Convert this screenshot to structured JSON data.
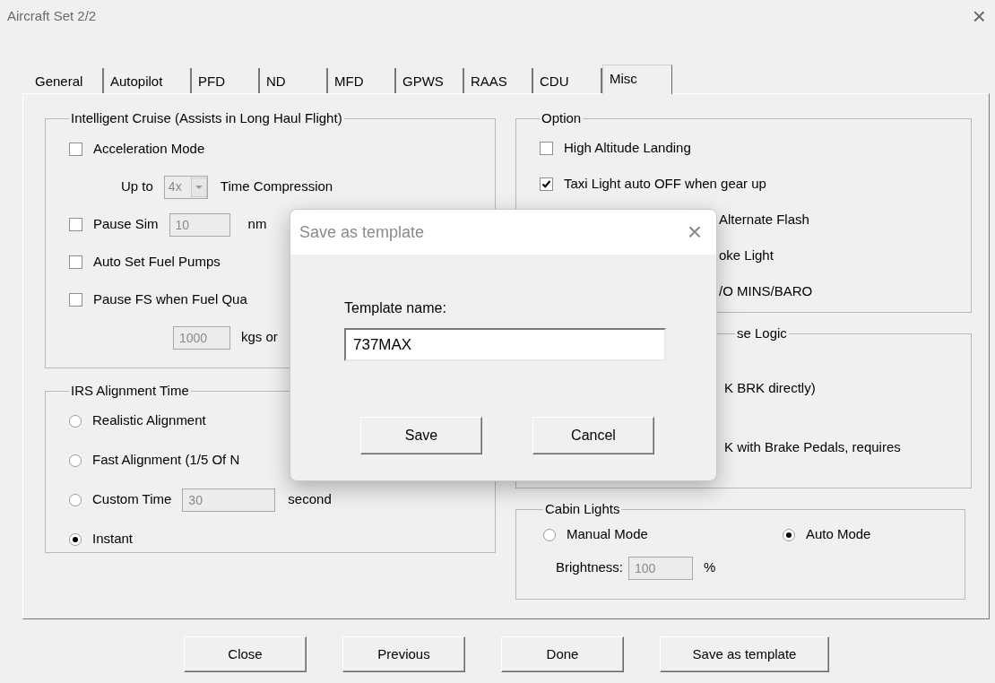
{
  "window": {
    "title": "Aircraft Set 2/2",
    "close": "×"
  },
  "tabs": [
    {
      "label": "General",
      "selected": false
    },
    {
      "label": "Autopilot",
      "selected": false
    },
    {
      "label": "PFD",
      "selected": false
    },
    {
      "label": "ND",
      "selected": false
    },
    {
      "label": "MFD",
      "selected": false
    },
    {
      "label": "GPWS",
      "selected": false
    },
    {
      "label": "RAAS",
      "selected": false
    },
    {
      "label": "CDU",
      "selected": false
    },
    {
      "label": "Misc",
      "selected": true
    }
  ],
  "intelligent_cruise": {
    "title": "Intelligent Cruise (Assists in Long Haul Flight)",
    "rows": [
      {
        "kind": "checkbox",
        "label": "Acceleration Mode",
        "checked": false
      },
      {
        "kind": "combo",
        "label": "Up to",
        "value": "4x",
        "suffix": "Time Compression"
      },
      {
        "kind": "checkbox_field",
        "label": "Pause Sim",
        "checked": false,
        "value": "10",
        "suffix": "nm"
      },
      {
        "kind": "checkbox",
        "label": "Auto Set Fuel Pumps",
        "checked": false
      },
      {
        "kind": "checkbox",
        "label": "Pause FS when Fuel Qua",
        "checked": false
      },
      {
        "kind": "field",
        "value": "1000",
        "suffix": "kgs or"
      }
    ]
  },
  "irs_alignment": {
    "title": "IRS Alignment Time",
    "rows": [
      {
        "kind": "radio",
        "label": "Realistic Alignment",
        "selected": false
      },
      {
        "kind": "radio",
        "label": "Fast Alignment (1/5 Of N",
        "selected": false
      },
      {
        "kind": "radio_field",
        "label": "Custom Time",
        "selected": false,
        "value": "30",
        "suffix": "second"
      },
      {
        "kind": "radio",
        "label": "Instant",
        "selected": true
      }
    ]
  },
  "option": {
    "title": "Option",
    "rows": [
      {
        "kind": "checkbox",
        "label": "High Altitude Landing",
        "checked": false
      },
      {
        "kind": "checkbox",
        "label": "Taxi Light auto OFF when gear up",
        "checked": true
      },
      {
        "kind": "partial",
        "label": "Alternate Flash"
      },
      {
        "kind": "partial",
        "label": "oke Light"
      },
      {
        "kind": "partial",
        "label": "/O MINS/BARO"
      }
    ]
  },
  "logic": {
    "title": "se Logic",
    "rows": [
      {
        "kind": "partial",
        "label": "K BRK directly)"
      },
      {
        "kind": "partial",
        "label": "K with Brake Pedals, requires"
      }
    ]
  },
  "cabin_lights": {
    "title": "Cabin Lights",
    "modes": [
      {
        "label": "Manual Mode",
        "selected": false
      },
      {
        "label": "Auto Mode",
        "selected": true
      }
    ],
    "brightness": {
      "label": "Brightness:",
      "value": "100",
      "suffix": "%"
    }
  },
  "buttons": [
    "Close",
    "Previous",
    "Done",
    "Save as template"
  ],
  "dialog": {
    "title": "Save as template",
    "close": "×",
    "field_label": "Template name:",
    "value": "737MAX",
    "buttons": [
      "Save",
      "Cancel"
    ]
  }
}
